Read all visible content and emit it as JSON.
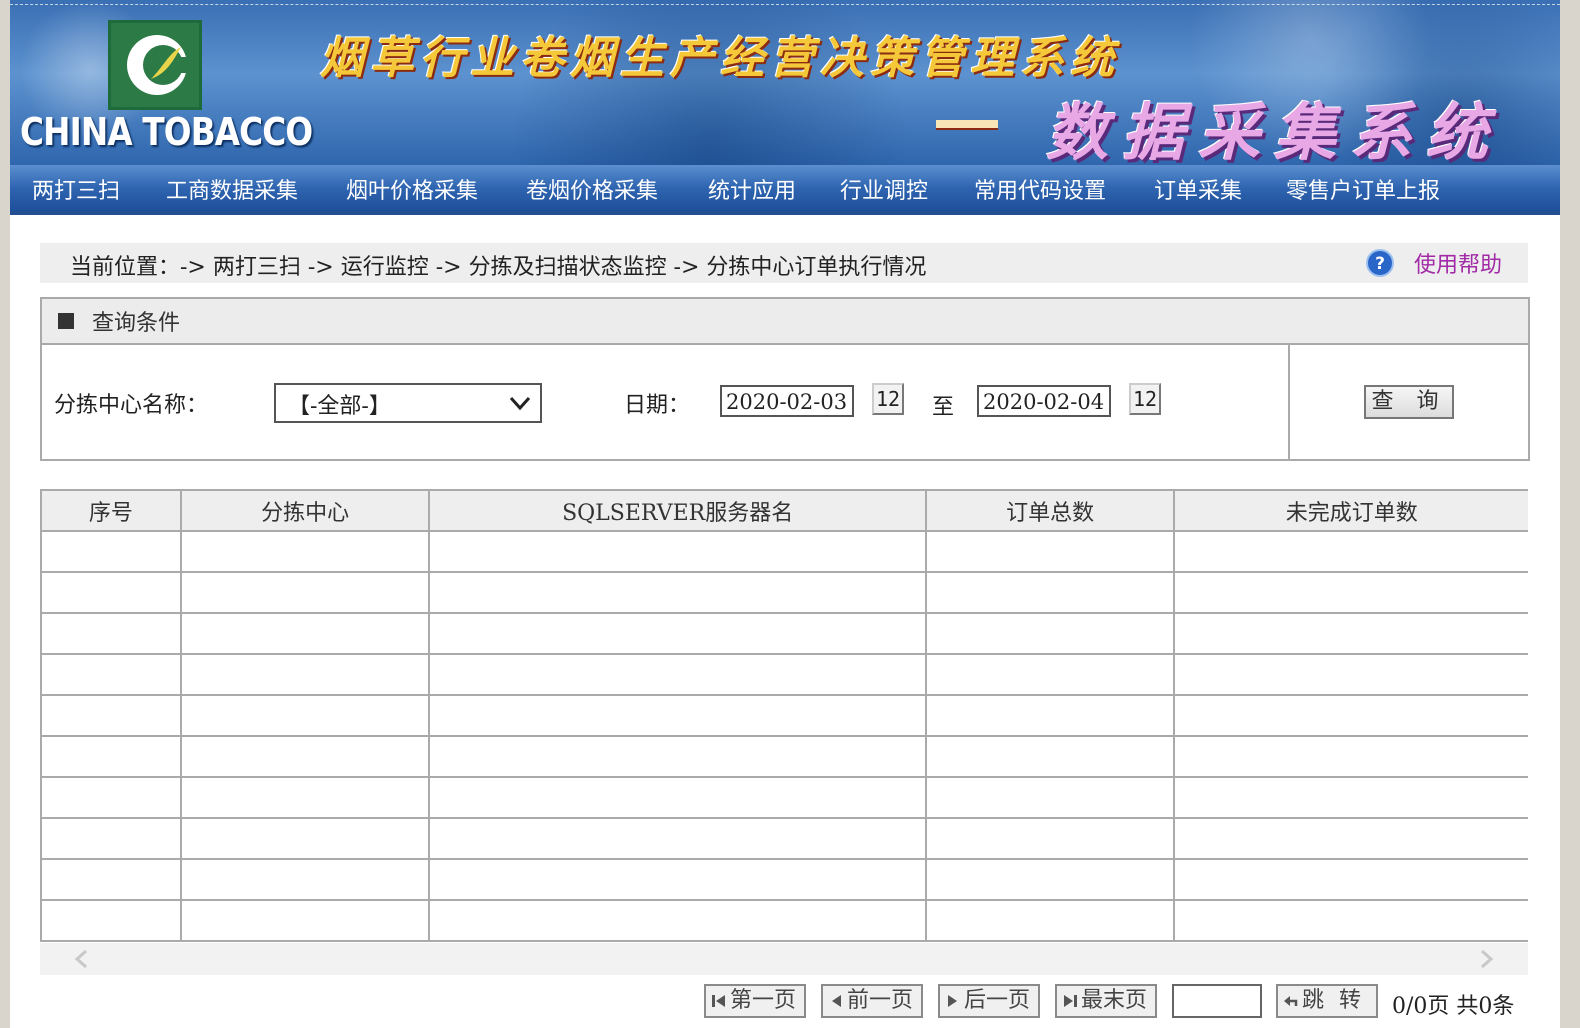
{
  "header": {
    "logo_text": "CHINA TOBACCO",
    "title_main": "烟草行业卷烟生产经营决策管理系统",
    "title_sub": "数据采集系统"
  },
  "nav": [
    {
      "label": "两打三扫"
    },
    {
      "label": "工商数据采集"
    },
    {
      "label": "烟叶价格采集"
    },
    {
      "label": "卷烟价格采集"
    },
    {
      "label": "统计应用"
    },
    {
      "label": "行业调控"
    },
    {
      "label": "常用代码设置"
    },
    {
      "label": "订单采集"
    },
    {
      "label": "零售户订单上报"
    }
  ],
  "breadcrumb": {
    "text": "当前位置：-> 两打三扫 -> 运行监控 -> 分拣及扫描状态监控 -> 分拣中心订单执行情况",
    "help_label": "使用帮助"
  },
  "query": {
    "title": "查询条件",
    "center_label": "分拣中心名称：",
    "center_selected": "【-全部-】",
    "date_label": "日期：",
    "date_from": "2020-02-03",
    "to_label": "至",
    "date_to": "2020-02-04",
    "calendar_label": "12",
    "query_button": "查 询"
  },
  "table": {
    "columns": [
      "序号",
      "分拣中心",
      "SQLSERVER服务器名",
      "订单总数",
      "未完成订单数"
    ]
  },
  "pager": {
    "first": "第一页",
    "prev": "前一页",
    "next": "后一页",
    "last": "最末页",
    "jump": "跳 转",
    "jump_value": "",
    "info": "0/0页  共0条"
  },
  "colors": {
    "banner_blue": "#3a6fb4",
    "nav_blue": "#2e64b0",
    "help_link": "#a12aa6"
  }
}
